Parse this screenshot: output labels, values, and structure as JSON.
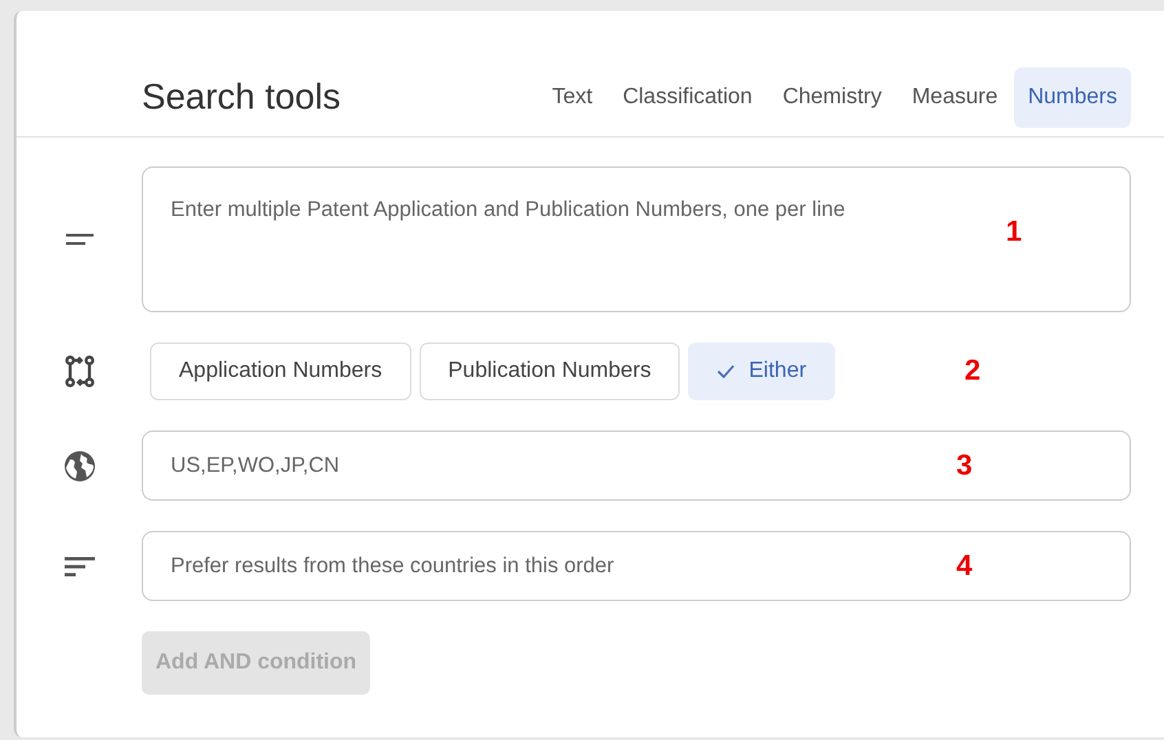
{
  "title": "Search tools",
  "tabs": [
    {
      "label": "Text",
      "selected": false
    },
    {
      "label": "Classification",
      "selected": false
    },
    {
      "label": "Chemistry",
      "selected": false
    },
    {
      "label": "Measure",
      "selected": false
    },
    {
      "label": "Numbers",
      "selected": true
    }
  ],
  "rows": [
    {
      "kind": "textarea",
      "placeholder": "Enter multiple Patent Application and Publication Numbers, one per line",
      "marker": "1"
    },
    {
      "kind": "chips",
      "chips": [
        {
          "label": "Application Numbers",
          "selected": false
        },
        {
          "label": "Publication Numbers",
          "selected": false
        },
        {
          "label": "Either",
          "selected": true
        }
      ],
      "marker": "2"
    },
    {
      "kind": "input",
      "placeholder": "US,EP,WO,JP,CN",
      "marker": "3"
    },
    {
      "kind": "input",
      "placeholder": "Prefer results from these countries in this order",
      "marker": "4"
    }
  ],
  "add_button": {
    "label": "Add AND condition",
    "disabled": true
  }
}
